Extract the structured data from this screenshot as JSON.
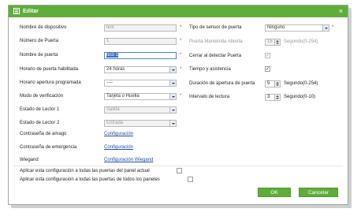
{
  "title": "Editar",
  "close_glyph": "×",
  "left": {
    "device_name_label": "Nombre de dispositivo",
    "device_name_value": "test",
    "door_number_label": "Número de Puerta",
    "door_number_value": "1",
    "door_name_label": "Nombre de puerta",
    "door_name_value": "test-1",
    "active_schedule_label": "Horario de puerta habilitada",
    "active_schedule_value": "24 horas",
    "open_schedule_label": "Horario apertura programada",
    "open_schedule_value": "----",
    "verify_mode_label": "Modo de verificación",
    "verify_mode_value": "Tarjeta o Huella",
    "reader1_label": "Estado de Lector 1",
    "reader1_value": "Salida",
    "reader2_label": "Estado de Lector 2",
    "reader2_value": "Entrada"
  },
  "right": {
    "sensor_type_label": "Tipo de sensor de puerta",
    "sensor_type_value": "Ninguno",
    "held_open_label": "Puerta Mantenida Abierta",
    "held_open_value": "15",
    "held_open_unit": "Segundo(0-254)",
    "close_on_sensor_label": "Cerrar al detectar Puerta",
    "time_attendance_label": "Tiempo y asistencia",
    "open_duration_label": "Duración de apertura de puerta",
    "open_duration_value": "5",
    "open_duration_unit": "Segundo(0-254)",
    "read_interval_label": "Intervalo de lectura",
    "read_interval_value": "3",
    "read_interval_unit": "Segundo(0-10)"
  },
  "passwords": {
    "threat_label": "Contraseña de amago",
    "threat_link": "Configuración",
    "emergency_label": "Contraseña de emergencia",
    "emergency_link": "Configuración",
    "wiegand_label": "Wiegand",
    "wiegand_link": "Configuración Wiegand"
  },
  "apply": {
    "current_panel": "Aplicar esta configuración a todas las puertas del panel actual",
    "all_panels": "Aplicar esta configuración a todas las puertas de todos los paneles"
  },
  "buttons": {
    "ok": "OK",
    "cancel": "Cancelar"
  },
  "required_mark": "*",
  "check_mark": "✓",
  "colors": {
    "header": "#5fae3a",
    "link": "#1f4fa8",
    "required": "#e03030"
  }
}
